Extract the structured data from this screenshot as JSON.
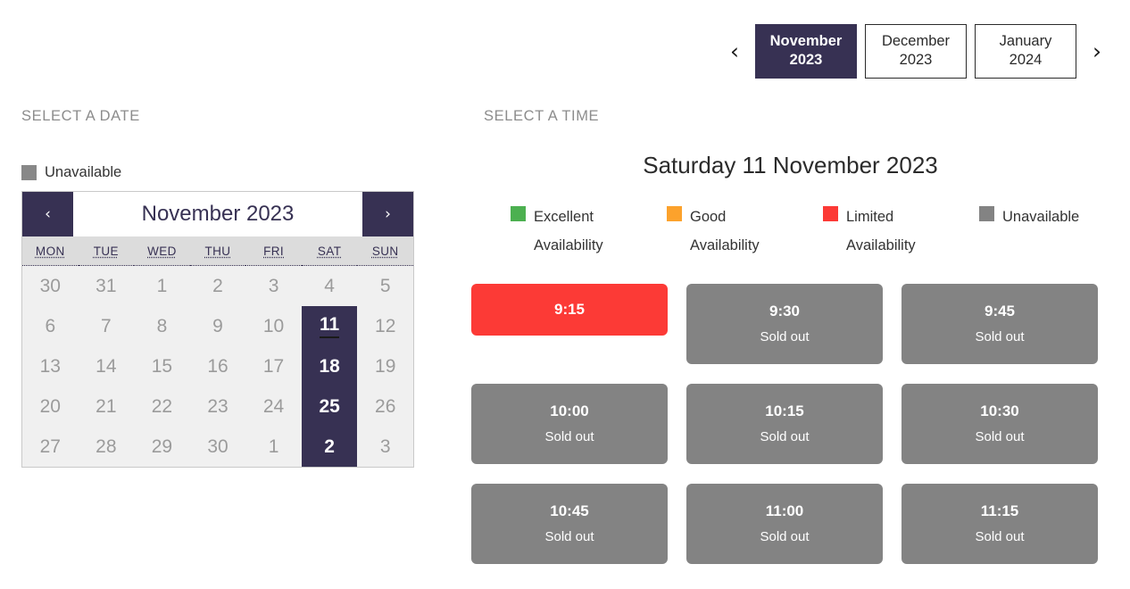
{
  "month_selector": {
    "prev_icon": "chevron-left-icon",
    "next_icon": "chevron-right-icon",
    "prev_label": "‹",
    "next_label": "›",
    "months": [
      {
        "name": "November",
        "year": "2023",
        "active": true
      },
      {
        "name": "December",
        "year": "2023",
        "active": false
      },
      {
        "name": "January",
        "year": "2024",
        "active": false
      }
    ]
  },
  "date_section": {
    "heading": "SELECT A DATE",
    "legend": {
      "swatch_color": "#888888",
      "label": "Unavailable"
    },
    "calendar": {
      "prev_label": "‹",
      "next_label": "›",
      "title": "November 2023",
      "dow_headers": [
        "MON",
        "TUE",
        "WED",
        "THU",
        "FRI",
        "SAT",
        "SUN"
      ],
      "cells": [
        {
          "day": "30",
          "state": "muted"
        },
        {
          "day": "31",
          "state": "muted"
        },
        {
          "day": "1",
          "state": "muted"
        },
        {
          "day": "2",
          "state": "muted"
        },
        {
          "day": "3",
          "state": "muted"
        },
        {
          "day": "4",
          "state": "muted"
        },
        {
          "day": "5",
          "state": "muted"
        },
        {
          "day": "6",
          "state": "muted"
        },
        {
          "day": "7",
          "state": "muted"
        },
        {
          "day": "8",
          "state": "muted"
        },
        {
          "day": "9",
          "state": "muted"
        },
        {
          "day": "10",
          "state": "muted"
        },
        {
          "day": "11",
          "state": "selected"
        },
        {
          "day": "12",
          "state": "muted"
        },
        {
          "day": "13",
          "state": "muted"
        },
        {
          "day": "14",
          "state": "muted"
        },
        {
          "day": "15",
          "state": "muted"
        },
        {
          "day": "16",
          "state": "muted"
        },
        {
          "day": "17",
          "state": "muted"
        },
        {
          "day": "18",
          "state": "available"
        },
        {
          "day": "19",
          "state": "muted"
        },
        {
          "day": "20",
          "state": "muted"
        },
        {
          "day": "21",
          "state": "muted"
        },
        {
          "day": "22",
          "state": "muted"
        },
        {
          "day": "23",
          "state": "muted"
        },
        {
          "day": "24",
          "state": "muted"
        },
        {
          "day": "25",
          "state": "available"
        },
        {
          "day": "26",
          "state": "muted"
        },
        {
          "day": "27",
          "state": "muted"
        },
        {
          "day": "28",
          "state": "muted"
        },
        {
          "day": "29",
          "state": "muted"
        },
        {
          "day": "30",
          "state": "muted"
        },
        {
          "day": "1",
          "state": "muted"
        },
        {
          "day": "2",
          "state": "available"
        },
        {
          "day": "3",
          "state": "muted"
        }
      ]
    }
  },
  "time_section": {
    "heading": "SELECT A TIME",
    "selected_date_title": "Saturday 11 November 2023",
    "availability_legend": [
      {
        "label": "Excellent Availability",
        "color": "#4cb050"
      },
      {
        "label": "Good Availability",
        "color": "#fca22c"
      },
      {
        "label": "Limited Availability",
        "color": "#fc3a36"
      },
      {
        "label": "Unavailable",
        "color": "#838383"
      }
    ],
    "slots": [
      {
        "time": "9:15",
        "note": "",
        "state": "limited"
      },
      {
        "time": "9:30",
        "note": "Sold out",
        "state": "sold-out"
      },
      {
        "time": "9:45",
        "note": "Sold out",
        "state": "sold-out"
      },
      {
        "time": "10:00",
        "note": "Sold out",
        "state": "sold-out"
      },
      {
        "time": "10:15",
        "note": "Sold out",
        "state": "sold-out"
      },
      {
        "time": "10:30",
        "note": "Sold out",
        "state": "sold-out"
      },
      {
        "time": "10:45",
        "note": "Sold out",
        "state": "sold-out"
      },
      {
        "time": "11:00",
        "note": "Sold out",
        "state": "sold-out"
      },
      {
        "time": "11:15",
        "note": "Sold out",
        "state": "sold-out"
      }
    ]
  },
  "theme": {
    "navy": "#373153",
    "grey_cell": "#f0f0f0",
    "dow_bg": "#dcdcdc",
    "muted_text": "#9b9b9b",
    "label_text": "#8c8c8c"
  }
}
